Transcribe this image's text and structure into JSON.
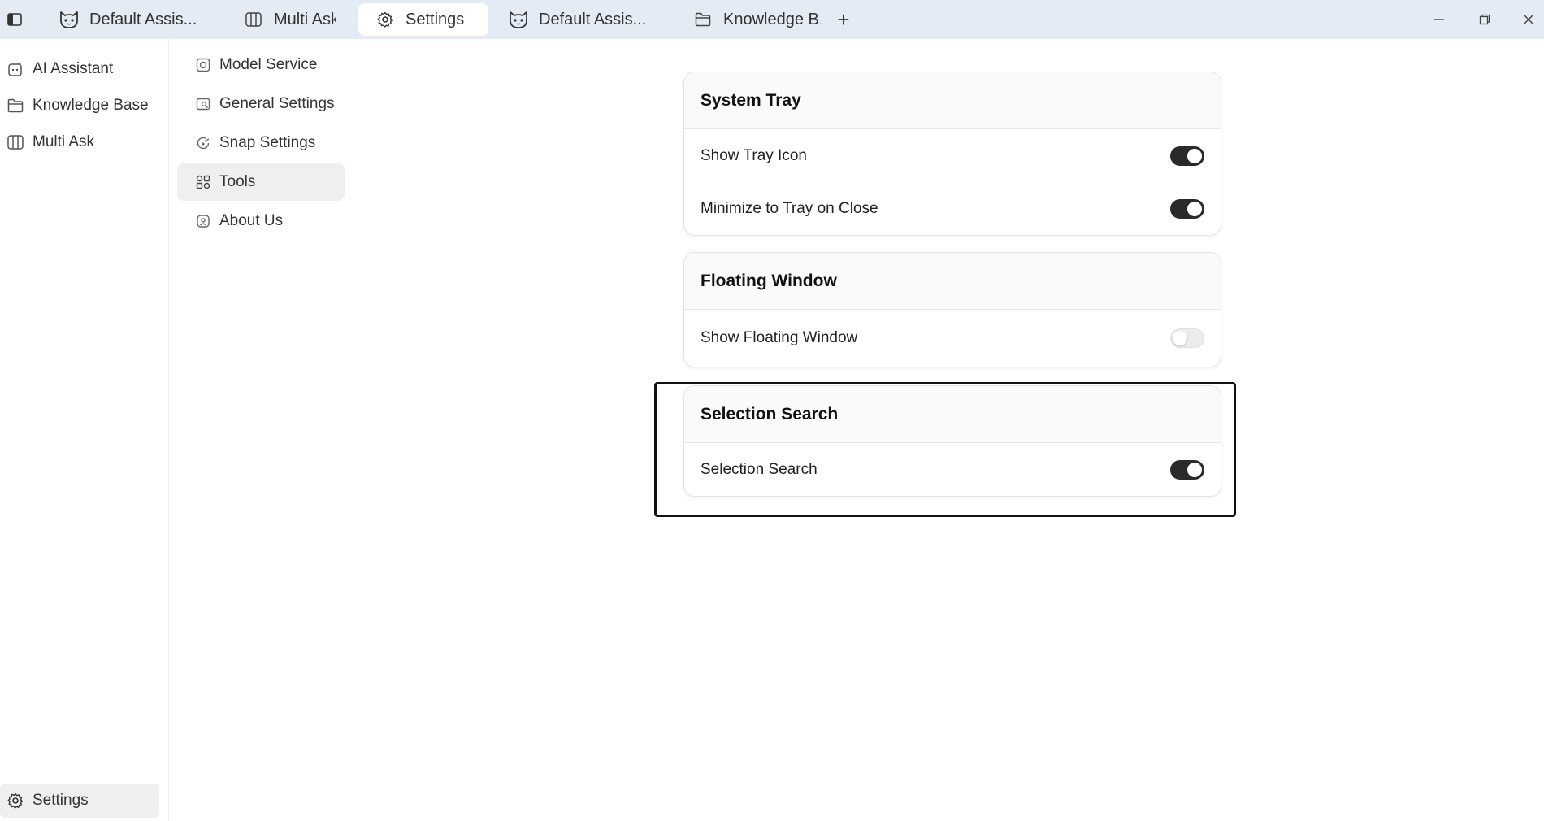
{
  "titlebar": {
    "tabs": [
      {
        "label": "Default Assis...",
        "icon": "cat-face-icon",
        "active": false
      },
      {
        "label": "Multi Ask",
        "icon": "columns-icon",
        "active": false
      },
      {
        "label": "Settings",
        "icon": "gear-icon",
        "active": true
      },
      {
        "label": "Default Assis...",
        "icon": "cat-face-icon",
        "active": false
      },
      {
        "label": "Knowledge B...",
        "icon": "folder-icon",
        "active": false
      }
    ],
    "add_tab": "+"
  },
  "leftnav": {
    "items": [
      {
        "label": "AI Assistant",
        "icon": "assistant-icon"
      },
      {
        "label": "Knowledge Base",
        "icon": "folder-icon"
      },
      {
        "label": "Multi Ask",
        "icon": "columns-icon"
      }
    ],
    "settings": {
      "label": "Settings",
      "icon": "gear-icon",
      "active": true
    }
  },
  "settings_menu": {
    "items": [
      {
        "label": "Model Service",
        "icon": "model-icon",
        "active": false
      },
      {
        "label": "General Settings",
        "icon": "general-icon",
        "active": false
      },
      {
        "label": "Snap Settings",
        "icon": "snap-icon",
        "active": false
      },
      {
        "label": "Tools",
        "icon": "tools-icon",
        "active": true
      },
      {
        "label": "About Us",
        "icon": "info-icon",
        "active": false
      }
    ]
  },
  "cards": {
    "system_tray": {
      "title": "System Tray",
      "rows": [
        {
          "label": "Show Tray Icon",
          "enabled": true
        },
        {
          "label": "Minimize to Tray on Close",
          "enabled": true
        }
      ]
    },
    "floating_window": {
      "title": "Floating Window",
      "rows": [
        {
          "label": "Show Floating Window",
          "enabled": false
        }
      ]
    },
    "selection_search": {
      "title": "Selection Search",
      "rows": [
        {
          "label": "Selection Search",
          "enabled": true
        }
      ]
    }
  },
  "colors": {
    "titlebar_bg": "#e4ebf5",
    "toggle_on": "#2a2a2a",
    "toggle_off": "#ececec",
    "active_item_bg": "#efefef"
  }
}
